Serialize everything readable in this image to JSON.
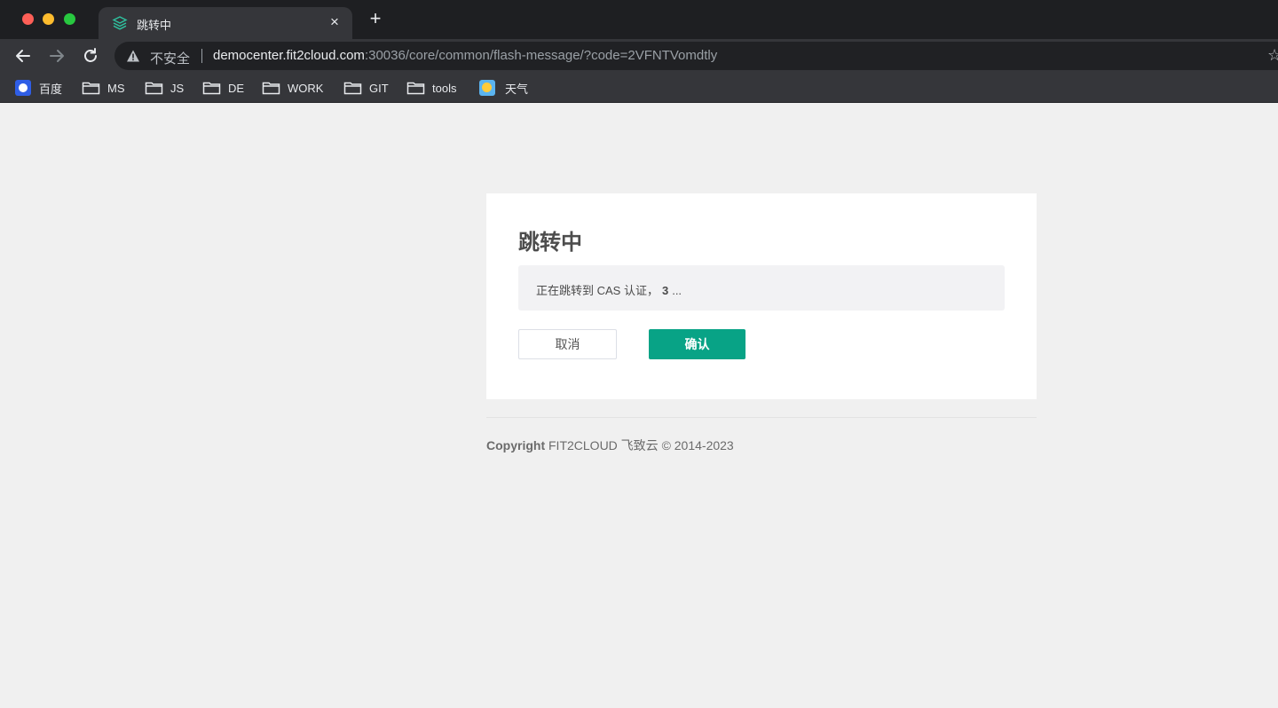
{
  "browser": {
    "tab_title": "跳转中",
    "tab_close": "×",
    "new_tab": "+",
    "insecure_label": "不安全",
    "url_host": "democenter.fit2cloud.com",
    "url_rest": ":30036/core/common/flash-message/?code=2VFNTVomdtly",
    "bookmarks": [
      {
        "label": "百度",
        "icon": "baidu-icon"
      },
      {
        "label": "MS",
        "icon": "folder-icon"
      },
      {
        "label": "JS",
        "icon": "folder-icon"
      },
      {
        "label": "DE",
        "icon": "folder-icon"
      },
      {
        "label": "WORK",
        "icon": "folder-icon"
      },
      {
        "label": "GIT",
        "icon": "folder-icon"
      },
      {
        "label": "tools",
        "icon": "folder-icon"
      },
      {
        "label": "天气",
        "icon": "weather-icon"
      }
    ]
  },
  "page": {
    "title": "跳转中",
    "message_prefix": "正在跳转到 CAS 认证，",
    "countdown": "3",
    "message_suffix": "...",
    "cancel_label": "取消",
    "confirm_label": "确认",
    "footer_bold": "Copyright",
    "footer_rest": " FIT2CLOUD 飞致云 © 2014-2023"
  },
  "colors": {
    "accent": "#08a386",
    "page_bg": "#f0f0f0"
  }
}
